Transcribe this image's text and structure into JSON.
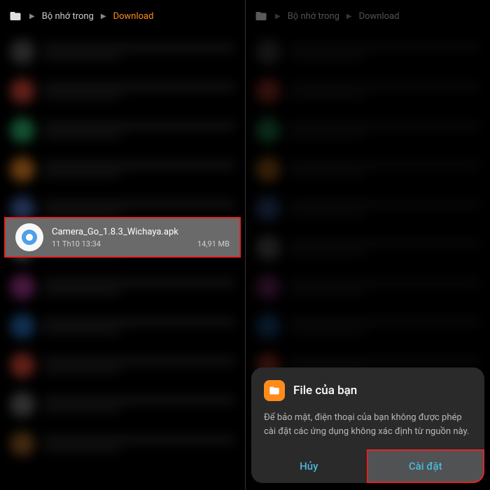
{
  "breadcrumb": {
    "root": "Bộ nhớ trong",
    "current": "Download"
  },
  "selectedFile": {
    "name": "Camera_Go_1.8.3_Wichaya.apk",
    "date": "11 Th10 13:34",
    "size": "14,91 MB"
  },
  "dialog": {
    "title": "File của bạn",
    "body": "Để bảo mật, điện thoại của bạn không được phép cài đặt các ứng dụng không xác định từ nguồn này.",
    "cancel": "Hủy",
    "install": "Cài đặt"
  },
  "blurColors": [
    "#505050",
    "#c04030",
    "#28a060",
    "#d07820",
    "#4060a0",
    "#707070",
    "#903080",
    "#2060a0",
    "#c04030",
    "#606060",
    "#805020"
  ]
}
